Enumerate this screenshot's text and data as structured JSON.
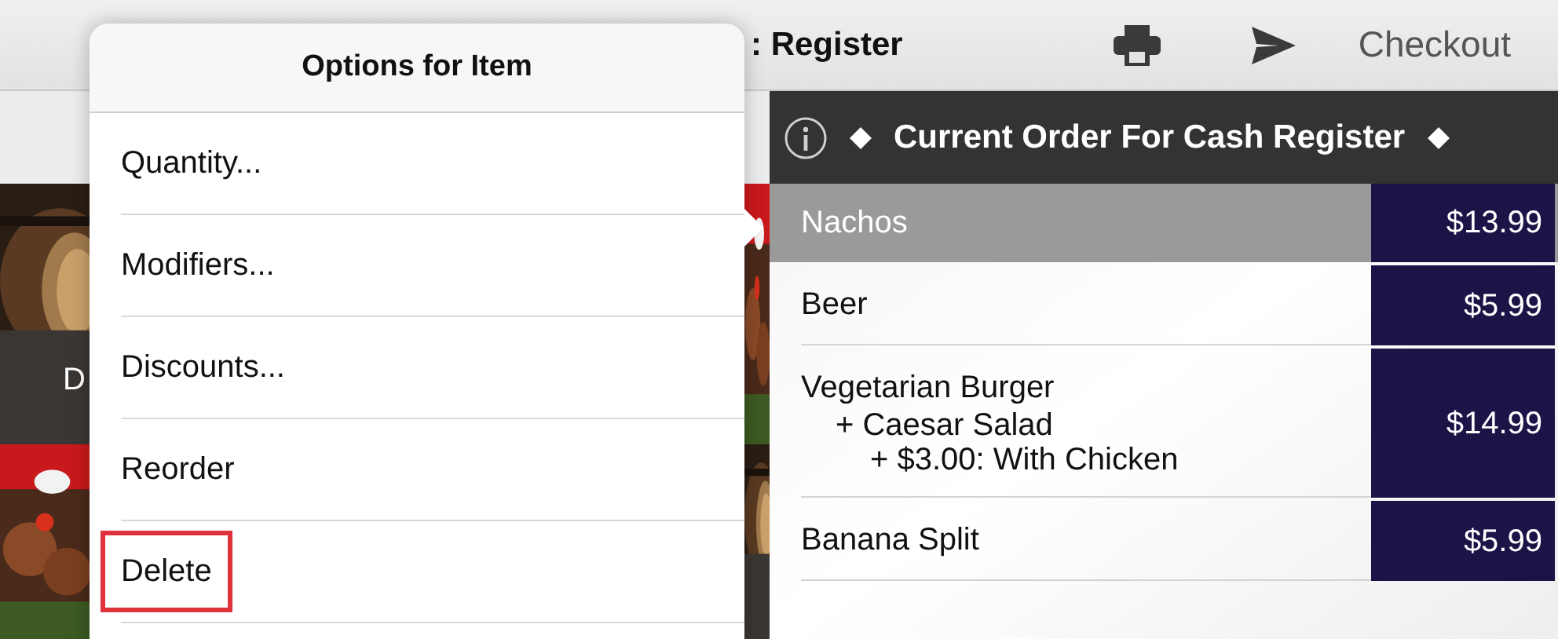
{
  "top_bar": {
    "title": ": Register",
    "checkout": "Checkout"
  },
  "menu_tiles": [
    {
      "kind": "picture",
      "label": "D"
    },
    {
      "kind": "picture"
    }
  ],
  "popover": {
    "title": "Options for Item",
    "items": [
      {
        "label": "Quantity...",
        "highlighted": false
      },
      {
        "label": "Modifiers...",
        "highlighted": false
      },
      {
        "label": "Discounts...",
        "highlighted": false
      },
      {
        "label": "Reorder",
        "highlighted": false
      },
      {
        "label": "Delete",
        "highlighted": true
      }
    ]
  },
  "order": {
    "title": "Current Order For Cash Register",
    "items": [
      {
        "name": "Nachos",
        "price": "$13.99",
        "selected": true
      },
      {
        "name": "Beer",
        "price": "$5.99",
        "selected": false
      },
      {
        "name": "Vegetarian Burger",
        "price": "$14.99",
        "selected": false,
        "modifiers": [
          {
            "label": "+ Caesar Salad",
            "children": [
              {
                "label": "+ $3.00: With Chicken"
              }
            ]
          }
        ]
      },
      {
        "name": "Banana Split",
        "price": "$5.99",
        "selected": false
      }
    ]
  }
}
